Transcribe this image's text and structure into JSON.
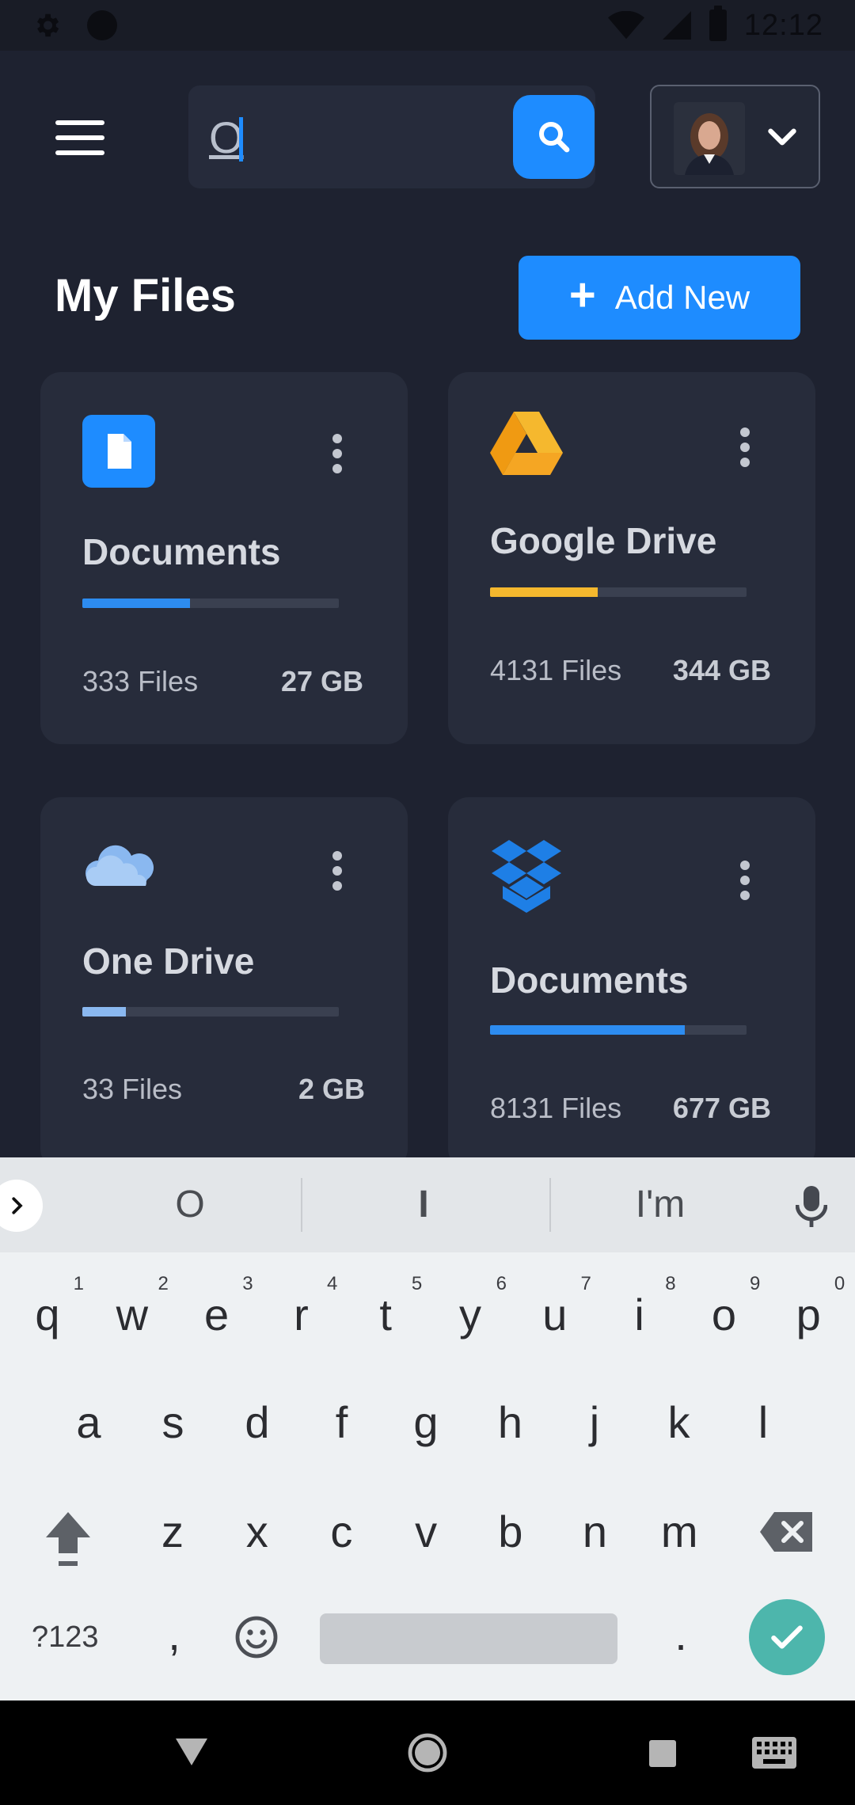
{
  "status_bar": {
    "time": "12:12"
  },
  "header": {
    "menu_icon": "hamburger-icon",
    "search": {
      "value": "O",
      "placeholder": ""
    },
    "search_icon": "search-icon",
    "profile_dropdown_icon": "chevron-down-icon"
  },
  "page": {
    "title": "My Files",
    "add_button": {
      "icon": "plus",
      "label": "Add New"
    }
  },
  "cards": [
    {
      "title": "Documents",
      "icon": "document-icon",
      "files": "333 Files",
      "size": "27 GB",
      "usage_fraction": 0.42,
      "color": "#2d8cf0"
    },
    {
      "title": "Google Drive",
      "icon": "google-drive-icon",
      "files": "4131 Files",
      "size": "344 GB",
      "usage_fraction": 0.42,
      "color": "#f5b82e"
    },
    {
      "title": "One Drive",
      "icon": "onedrive-cloud-icon",
      "files": "33 Files",
      "size": "2 GB",
      "usage_fraction": 0.17,
      "color": "#8ab8f0"
    },
    {
      "title": "Documents",
      "icon": "dropbox-icon",
      "files": "8131 Files",
      "size": "677 GB",
      "usage_fraction": 0.76,
      "color": "#2d8cf0"
    }
  ],
  "keyboard": {
    "suggestions": [
      "O",
      "I",
      "I'm"
    ],
    "row1": [
      {
        "key": "q",
        "hint": "1"
      },
      {
        "key": "w",
        "hint": "2"
      },
      {
        "key": "e",
        "hint": "3"
      },
      {
        "key": "r",
        "hint": "4"
      },
      {
        "key": "t",
        "hint": "5"
      },
      {
        "key": "y",
        "hint": "6"
      },
      {
        "key": "u",
        "hint": "7"
      },
      {
        "key": "i",
        "hint": "8"
      },
      {
        "key": "o",
        "hint": "9"
      },
      {
        "key": "p",
        "hint": "0"
      }
    ],
    "row2": [
      "a",
      "s",
      "d",
      "f",
      "g",
      "h",
      "j",
      "k",
      "l"
    ],
    "row3": [
      "z",
      "x",
      "c",
      "v",
      "b",
      "n",
      "m"
    ],
    "symbols_label": "?123",
    "comma": ",",
    "period": "."
  },
  "colors": {
    "accent": "#1e8cff",
    "background": "#1e2230",
    "card": "#272c3b",
    "enter_key": "#4db6ac"
  }
}
